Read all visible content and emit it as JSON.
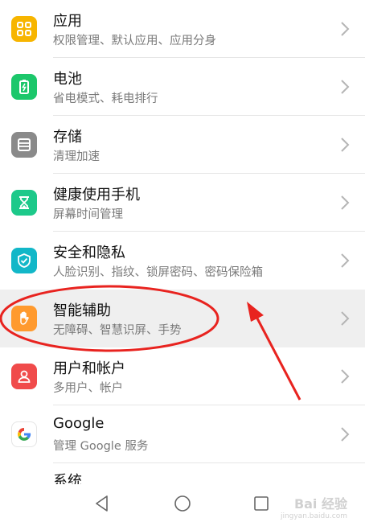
{
  "settings": {
    "items": [
      {
        "title": "应用",
        "subtitle": "权限管理、默认应用、应用分身",
        "icon": "apps-icon",
        "color": "#f7b500"
      },
      {
        "title": "电池",
        "subtitle": "省电模式、耗电排行",
        "icon": "battery-icon",
        "color": "#1cc76b"
      },
      {
        "title": "存储",
        "subtitle": "清理加速",
        "icon": "storage-icon",
        "color": "#8a8a8a"
      },
      {
        "title": "健康使用手机",
        "subtitle": "屏幕时间管理",
        "icon": "hourglass-icon",
        "color": "#1dc98a"
      },
      {
        "title": "安全和隐私",
        "subtitle": "人脸识别、指纹、锁屏密码、密码保险箱",
        "icon": "shield-icon",
        "color": "#12b7c8"
      },
      {
        "title": "智能辅助",
        "subtitle": "无障碍、智慧识屏、手势",
        "icon": "hand-icon",
        "color": "#ff9a2e"
      },
      {
        "title": "用户和帐户",
        "subtitle": "多用户、帐户",
        "icon": "user-icon",
        "color": "#f04b4b"
      },
      {
        "title": "Google",
        "subtitle": "管理 Google 服务",
        "icon": "google-icon",
        "color": "#ffffff"
      }
    ],
    "partial_item_title": "系统"
  },
  "navbar": {
    "back": "back-icon",
    "home": "home-icon",
    "recents": "recents-icon"
  },
  "watermark": {
    "brand": "Bai 经验",
    "url": "jingyan.baidu.com"
  },
  "annotation": {
    "highlight_color": "#e8231f"
  }
}
